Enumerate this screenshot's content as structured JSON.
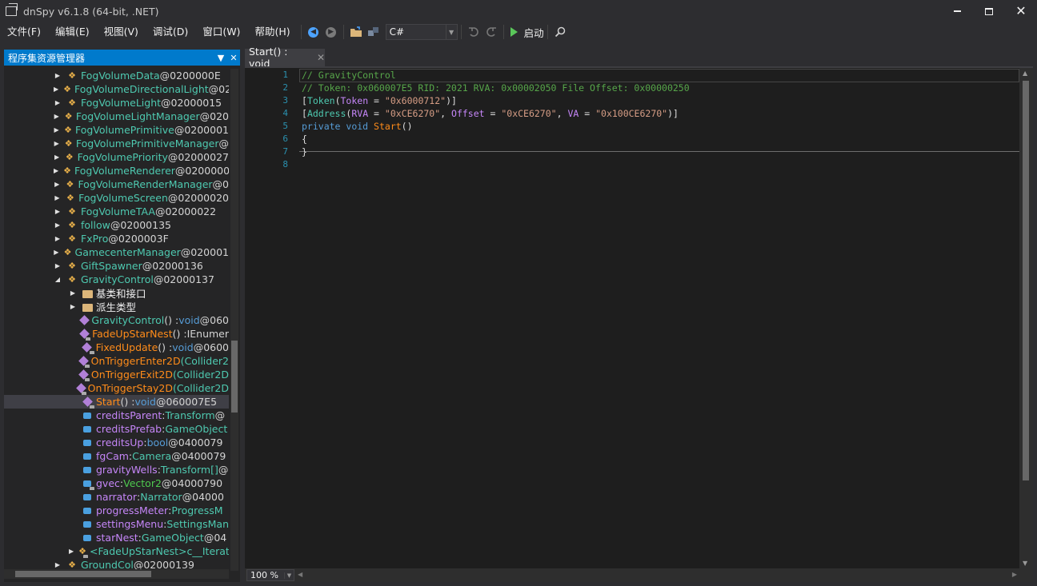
{
  "window": {
    "title": "dnSpy v6.1.8 (64-bit, .NET)",
    "min_glyph": "",
    "max_glyph": "",
    "close_glyph": "✕"
  },
  "menu": [
    "文件(F)",
    "编辑(E)",
    "视图(V)",
    "调试(D)",
    "窗口(W)",
    "帮助(H)"
  ],
  "toolbar": {
    "language": "C#",
    "start_label": "启动"
  },
  "assembly_explorer": {
    "title": "程序集资源管理器",
    "rows": [
      {
        "indent": 0,
        "arrow": "▶",
        "icon": "class",
        "parts": [
          {
            "t": "FogVolumeData",
            "c": "t-type"
          },
          {
            "t": " @0200000E",
            "c": "t-tok"
          }
        ]
      },
      {
        "indent": 0,
        "arrow": "▶",
        "icon": "class",
        "parts": [
          {
            "t": "FogVolumeDirectionalLight",
            "c": "t-type"
          },
          {
            "t": " @02",
            "c": "t-tok"
          }
        ]
      },
      {
        "indent": 0,
        "arrow": "▶",
        "icon": "class",
        "parts": [
          {
            "t": "FogVolumeLight",
            "c": "t-type"
          },
          {
            "t": " @02000015",
            "c": "t-tok"
          }
        ]
      },
      {
        "indent": 0,
        "arrow": "▶",
        "icon": "class",
        "parts": [
          {
            "t": "FogVolumeLightManager",
            "c": "t-type"
          },
          {
            "t": " @020",
            "c": "t-tok"
          }
        ]
      },
      {
        "indent": 0,
        "arrow": "▶",
        "icon": "class",
        "parts": [
          {
            "t": "FogVolumePrimitive",
            "c": "t-type"
          },
          {
            "t": " @0200001",
            "c": "t-tok"
          }
        ]
      },
      {
        "indent": 0,
        "arrow": "▶",
        "icon": "class",
        "parts": [
          {
            "t": "FogVolumePrimitiveManager",
            "c": "t-type"
          },
          {
            "t": " @",
            "c": "t-tok"
          }
        ]
      },
      {
        "indent": 0,
        "arrow": "▶",
        "icon": "class",
        "parts": [
          {
            "t": "FogVolumePriority",
            "c": "t-type"
          },
          {
            "t": " @02000027",
            "c": "t-tok"
          }
        ]
      },
      {
        "indent": 0,
        "arrow": "▶",
        "icon": "class",
        "parts": [
          {
            "t": "FogVolumeRenderer",
            "c": "t-type"
          },
          {
            "t": " @0200000",
            "c": "t-tok"
          }
        ]
      },
      {
        "indent": 0,
        "arrow": "▶",
        "icon": "class",
        "parts": [
          {
            "t": "FogVolumeRenderManager",
            "c": "t-type"
          },
          {
            "t": " @0",
            "c": "t-tok"
          }
        ]
      },
      {
        "indent": 0,
        "arrow": "▶",
        "icon": "class",
        "parts": [
          {
            "t": "FogVolumeScreen",
            "c": "t-type"
          },
          {
            "t": " @02000020",
            "c": "t-tok"
          }
        ]
      },
      {
        "indent": 0,
        "arrow": "▶",
        "icon": "class",
        "parts": [
          {
            "t": "FogVolumeTAA",
            "c": "t-type"
          },
          {
            "t": " @02000022",
            "c": "t-tok"
          }
        ]
      },
      {
        "indent": 0,
        "arrow": "▶",
        "icon": "class",
        "parts": [
          {
            "t": "follow",
            "c": "t-type"
          },
          {
            "t": " @02000135",
            "c": "t-tok"
          }
        ]
      },
      {
        "indent": 0,
        "arrow": "▶",
        "icon": "class",
        "parts": [
          {
            "t": "FxPro",
            "c": "t-type"
          },
          {
            "t": " @0200003F",
            "c": "t-tok"
          }
        ]
      },
      {
        "indent": 0,
        "arrow": "▶",
        "icon": "class",
        "parts": [
          {
            "t": "GamecenterManager",
            "c": "t-type"
          },
          {
            "t": " @020001",
            "c": "t-tok"
          }
        ]
      },
      {
        "indent": 0,
        "arrow": "▶",
        "icon": "class",
        "parts": [
          {
            "t": "GiftSpawner",
            "c": "t-type"
          },
          {
            "t": " @02000136",
            "c": "t-tok"
          }
        ]
      },
      {
        "indent": 0,
        "arrow": "◢",
        "icon": "class",
        "parts": [
          {
            "t": "GravityControl",
            "c": "t-type"
          },
          {
            "t": " @02000137",
            "c": "t-tok"
          }
        ]
      },
      {
        "indent": 1,
        "arrow": "▶",
        "icon": "folder",
        "parts": [
          {
            "t": "基类和接口",
            "c": "t-white"
          }
        ]
      },
      {
        "indent": 1,
        "arrow": "▶",
        "icon": "folder",
        "parts": [
          {
            "t": "派生类型",
            "c": "t-white"
          }
        ]
      },
      {
        "indent": 1,
        "arrow": "",
        "icon": "method",
        "parts": [
          {
            "t": "GravityControl",
            "c": "t-type"
          },
          {
            "t": "() : ",
            "c": "t-punct"
          },
          {
            "t": "void",
            "c": "t-kw"
          },
          {
            "t": " @060",
            "c": "t-tok"
          }
        ]
      },
      {
        "indent": 1,
        "arrow": "",
        "icon": "method-lock",
        "parts": [
          {
            "t": "FadeUpStarNest",
            "c": "t-method"
          },
          {
            "t": "() : ",
            "c": "t-punct"
          },
          {
            "t": "IEnumer",
            "c": "t-tok"
          }
        ]
      },
      {
        "indent": 1,
        "arrow": "",
        "icon": "method-lock",
        "parts": [
          {
            "t": "FixedUpdate",
            "c": "t-method"
          },
          {
            "t": "() : ",
            "c": "t-punct"
          },
          {
            "t": "void",
            "c": "t-kw"
          },
          {
            "t": " @0600",
            "c": "t-tok"
          }
        ]
      },
      {
        "indent": 1,
        "arrow": "",
        "icon": "method-lock",
        "parts": [
          {
            "t": "OnTriggerEnter2D",
            "c": "t-method"
          },
          {
            "t": "(Collider2",
            "c": "t-type"
          }
        ]
      },
      {
        "indent": 1,
        "arrow": "",
        "icon": "method-lock",
        "parts": [
          {
            "t": "OnTriggerExit2D",
            "c": "t-method"
          },
          {
            "t": "(Collider2D",
            "c": "t-type"
          }
        ]
      },
      {
        "indent": 1,
        "arrow": "",
        "icon": "method-lock",
        "parts": [
          {
            "t": "OnTriggerStay2D",
            "c": "t-method"
          },
          {
            "t": "(Collider2D",
            "c": "t-type"
          }
        ]
      },
      {
        "indent": 1,
        "arrow": "",
        "icon": "method-lock",
        "selected": true,
        "parts": [
          {
            "t": "Start",
            "c": "t-method"
          },
          {
            "t": "() : ",
            "c": "t-punct"
          },
          {
            "t": "void",
            "c": "t-kw"
          },
          {
            "t": " @060007E5",
            "c": "t-tok"
          }
        ]
      },
      {
        "indent": 1,
        "arrow": "",
        "icon": "field",
        "parts": [
          {
            "t": "creditsParent",
            "c": "t-field"
          },
          {
            "t": " : ",
            "c": "t-punct"
          },
          {
            "t": "Transform",
            "c": "t-type"
          },
          {
            "t": " @",
            "c": "t-tok"
          }
        ]
      },
      {
        "indent": 1,
        "arrow": "",
        "icon": "field",
        "parts": [
          {
            "t": "creditsPrefab",
            "c": "t-field"
          },
          {
            "t": " : ",
            "c": "t-punct"
          },
          {
            "t": "GameObject",
            "c": "t-type"
          }
        ]
      },
      {
        "indent": 1,
        "arrow": "",
        "icon": "field",
        "parts": [
          {
            "t": "creditsUp",
            "c": "t-field"
          },
          {
            "t": " : ",
            "c": "t-punct"
          },
          {
            "t": "bool",
            "c": "t-kw"
          },
          {
            "t": " @0400079",
            "c": "t-tok"
          }
        ]
      },
      {
        "indent": 1,
        "arrow": "",
        "icon": "field",
        "parts": [
          {
            "t": "fgCam",
            "c": "t-field"
          },
          {
            "t": " : ",
            "c": "t-punct"
          },
          {
            "t": "Camera",
            "c": "t-type"
          },
          {
            "t": " @0400079",
            "c": "t-tok"
          }
        ]
      },
      {
        "indent": 1,
        "arrow": "",
        "icon": "field",
        "parts": [
          {
            "t": "gravityWells",
            "c": "t-field"
          },
          {
            "t": " : ",
            "c": "t-punct"
          },
          {
            "t": "Transform[]",
            "c": "t-type"
          },
          {
            "t": " @",
            "c": "t-tok"
          }
        ]
      },
      {
        "indent": 1,
        "arrow": "",
        "icon": "field-lock",
        "parts": [
          {
            "t": "gvec",
            "c": "t-field"
          },
          {
            "t": " : ",
            "c": "t-punct"
          },
          {
            "t": "Vector2",
            "c": "t-vec"
          },
          {
            "t": " @04000790",
            "c": "t-tok"
          }
        ]
      },
      {
        "indent": 1,
        "arrow": "",
        "icon": "field",
        "parts": [
          {
            "t": "narrator",
            "c": "t-field"
          },
          {
            "t": " : ",
            "c": "t-punct"
          },
          {
            "t": "Narrator",
            "c": "t-type"
          },
          {
            "t": " @04000",
            "c": "t-tok"
          }
        ]
      },
      {
        "indent": 1,
        "arrow": "",
        "icon": "field",
        "parts": [
          {
            "t": "progressMeter",
            "c": "t-field"
          },
          {
            "t": " : ",
            "c": "t-punct"
          },
          {
            "t": "ProgressM",
            "c": "t-type"
          }
        ]
      },
      {
        "indent": 1,
        "arrow": "",
        "icon": "field",
        "parts": [
          {
            "t": "settingsMenu",
            "c": "t-field"
          },
          {
            "t": " : ",
            "c": "t-punct"
          },
          {
            "t": "SettingsMan",
            "c": "t-type"
          }
        ]
      },
      {
        "indent": 1,
        "arrow": "",
        "icon": "field",
        "parts": [
          {
            "t": "starNest",
            "c": "t-field"
          },
          {
            "t": " : ",
            "c": "t-punct"
          },
          {
            "t": "GameObject",
            "c": "t-type"
          },
          {
            "t": " @04",
            "c": "t-tok"
          }
        ]
      },
      {
        "indent": 1,
        "arrow": "▶",
        "icon": "class-lock",
        "parts": [
          {
            "t": "<FadeUpStarNest>c__Iterat",
            "c": "t-type"
          }
        ]
      },
      {
        "indent": 0,
        "arrow": "▶",
        "icon": "class",
        "parts": [
          {
            "t": "GroundCol",
            "c": "t-type"
          },
          {
            "t": " @02000139",
            "c": "t-tok"
          }
        ]
      }
    ]
  },
  "editor": {
    "tab_title": "Start() : void",
    "zoom": "100 %",
    "lines": [
      [
        {
          "t": "// GravityControl",
          "c": "c-comment"
        }
      ],
      [
        {
          "t": "// Token: 0x060007E5 RID: 2021 RVA: 0x00002050 File Offset: 0x00000250",
          "c": "c-comment"
        }
      ],
      [
        {
          "t": "[",
          "c": "c-punct"
        },
        {
          "t": "Token",
          "c": "c-type"
        },
        {
          "t": "(",
          "c": "c-punct"
        },
        {
          "t": "Token",
          "c": "c-prop"
        },
        {
          "t": " = ",
          "c": "c-punct"
        },
        {
          "t": "\"0x6000712\"",
          "c": "c-str"
        },
        {
          "t": ")]",
          "c": "c-punct"
        }
      ],
      [
        {
          "t": "[",
          "c": "c-punct"
        },
        {
          "t": "Address",
          "c": "c-type"
        },
        {
          "t": "(",
          "c": "c-punct"
        },
        {
          "t": "RVA",
          "c": "c-prop"
        },
        {
          "t": " = ",
          "c": "c-punct"
        },
        {
          "t": "\"0xCE6270\"",
          "c": "c-str"
        },
        {
          "t": ", ",
          "c": "c-punct"
        },
        {
          "t": "Offset",
          "c": "c-prop"
        },
        {
          "t": " = ",
          "c": "c-punct"
        },
        {
          "t": "\"0xCE6270\"",
          "c": "c-str"
        },
        {
          "t": ", ",
          "c": "c-punct"
        },
        {
          "t": "VA",
          "c": "c-prop"
        },
        {
          "t": " = ",
          "c": "c-punct"
        },
        {
          "t": "\"0x100CE6270\"",
          "c": "c-str"
        },
        {
          "t": ")]",
          "c": "c-punct"
        }
      ],
      [
        {
          "t": "private",
          "c": "c-kw"
        },
        {
          "t": " ",
          "c": "c-punct"
        },
        {
          "t": "void",
          "c": "c-kw"
        },
        {
          "t": " ",
          "c": "c-punct"
        },
        {
          "t": "Start",
          "c": "c-method"
        },
        {
          "t": "()",
          "c": "c-punct"
        }
      ],
      [
        {
          "t": "{",
          "c": "c-punct"
        }
      ],
      [
        {
          "t": "}",
          "c": "c-punct"
        }
      ],
      [
        {
          "t": "",
          "c": "c-punct"
        }
      ]
    ]
  }
}
